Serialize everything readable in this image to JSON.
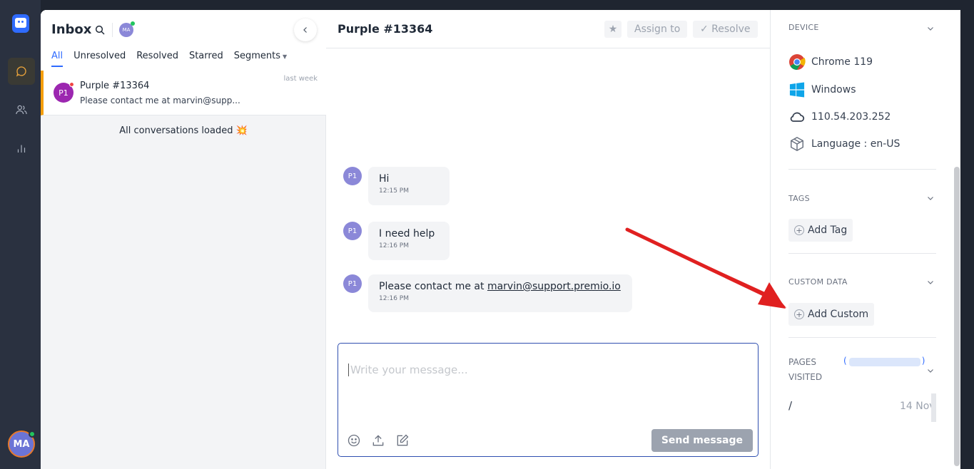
{
  "inbox": {
    "title": "Inbox",
    "agent_initials": "MA",
    "tabs": [
      {
        "label": "All"
      },
      {
        "label": "Unresolved"
      },
      {
        "label": "Resolved"
      },
      {
        "label": "Starred"
      },
      {
        "label": "Segments"
      }
    ],
    "conversations": [
      {
        "initials": "P1",
        "name": "Purple #13364",
        "preview": "Please contact me at marvin@supp...",
        "time": "last week"
      }
    ],
    "loaded_text": "All conversations loaded 💥"
  },
  "chat": {
    "title": "Purple #13364",
    "assign_label": "Assign to",
    "resolve_label": "✓ Resolve",
    "messages": [
      {
        "initials": "P1",
        "text": "Hi",
        "time": "12:15 PM"
      },
      {
        "initials": "P1",
        "text": "I need help",
        "time": "12:16 PM"
      },
      {
        "initials": "P1",
        "text_prefix": "Please contact me at ",
        "email": "marvin@support.premio.io",
        "time": "12:16 PM"
      }
    ],
    "composer_placeholder": "Write your message...",
    "send_label": "Send message"
  },
  "sidebar": {
    "device": {
      "label": "DEVICE",
      "browser": "Chrome 119",
      "os": "Windows",
      "ip": "110.54.203.252",
      "language": "Language : en-US"
    },
    "tags": {
      "label": "TAGS",
      "add_label": "Add Tag"
    },
    "custom_data": {
      "label": "CUSTOM DATA",
      "add_label": "Add Custom"
    },
    "pages_visited": {
      "label_line1": "PAGES",
      "label_line2": "VISITED",
      "count_open": "(",
      "count_close": ")",
      "path": "/",
      "date": "14 Nov"
    }
  },
  "user": {
    "initials": "MA"
  },
  "colors": {
    "accent": "#2f6bff",
    "arrow": "#e02020",
    "unread": "#f59e0b"
  }
}
